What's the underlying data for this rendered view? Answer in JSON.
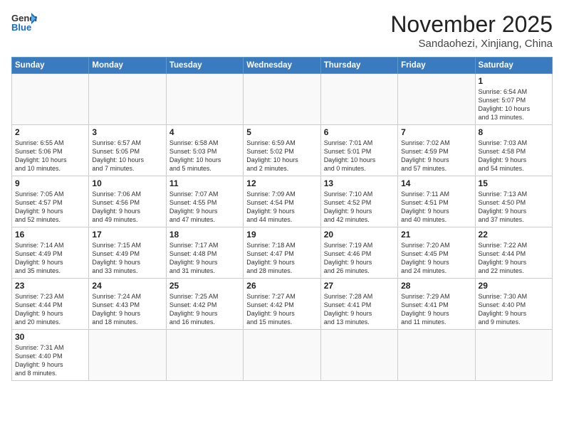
{
  "logo": {
    "text_general": "General",
    "text_blue": "Blue"
  },
  "header": {
    "month": "November 2025",
    "location": "Sandaohezi, Xinjiang, China"
  },
  "weekdays": [
    "Sunday",
    "Monday",
    "Tuesday",
    "Wednesday",
    "Thursday",
    "Friday",
    "Saturday"
  ],
  "weeks": [
    [
      null,
      null,
      null,
      null,
      null,
      null,
      {
        "day": "1",
        "info": "Sunrise: 6:54 AM\nSunset: 5:07 PM\nDaylight: 10 hours\nand 13 minutes."
      }
    ],
    [
      {
        "day": "2",
        "info": "Sunrise: 6:55 AM\nSunset: 5:06 PM\nDaylight: 10 hours\nand 10 minutes."
      },
      {
        "day": "3",
        "info": "Sunrise: 6:57 AM\nSunset: 5:05 PM\nDaylight: 10 hours\nand 7 minutes."
      },
      {
        "day": "4",
        "info": "Sunrise: 6:58 AM\nSunset: 5:03 PM\nDaylight: 10 hours\nand 5 minutes."
      },
      {
        "day": "5",
        "info": "Sunrise: 6:59 AM\nSunset: 5:02 PM\nDaylight: 10 hours\nand 2 minutes."
      },
      {
        "day": "6",
        "info": "Sunrise: 7:01 AM\nSunset: 5:01 PM\nDaylight: 10 hours\nand 0 minutes."
      },
      {
        "day": "7",
        "info": "Sunrise: 7:02 AM\nSunset: 4:59 PM\nDaylight: 9 hours\nand 57 minutes."
      },
      {
        "day": "8",
        "info": "Sunrise: 7:03 AM\nSunset: 4:58 PM\nDaylight: 9 hours\nand 54 minutes."
      }
    ],
    [
      {
        "day": "9",
        "info": "Sunrise: 7:05 AM\nSunset: 4:57 PM\nDaylight: 9 hours\nand 52 minutes."
      },
      {
        "day": "10",
        "info": "Sunrise: 7:06 AM\nSunset: 4:56 PM\nDaylight: 9 hours\nand 49 minutes."
      },
      {
        "day": "11",
        "info": "Sunrise: 7:07 AM\nSunset: 4:55 PM\nDaylight: 9 hours\nand 47 minutes."
      },
      {
        "day": "12",
        "info": "Sunrise: 7:09 AM\nSunset: 4:54 PM\nDaylight: 9 hours\nand 44 minutes."
      },
      {
        "day": "13",
        "info": "Sunrise: 7:10 AM\nSunset: 4:52 PM\nDaylight: 9 hours\nand 42 minutes."
      },
      {
        "day": "14",
        "info": "Sunrise: 7:11 AM\nSunset: 4:51 PM\nDaylight: 9 hours\nand 40 minutes."
      },
      {
        "day": "15",
        "info": "Sunrise: 7:13 AM\nSunset: 4:50 PM\nDaylight: 9 hours\nand 37 minutes."
      }
    ],
    [
      {
        "day": "16",
        "info": "Sunrise: 7:14 AM\nSunset: 4:49 PM\nDaylight: 9 hours\nand 35 minutes."
      },
      {
        "day": "17",
        "info": "Sunrise: 7:15 AM\nSunset: 4:49 PM\nDaylight: 9 hours\nand 33 minutes."
      },
      {
        "day": "18",
        "info": "Sunrise: 7:17 AM\nSunset: 4:48 PM\nDaylight: 9 hours\nand 31 minutes."
      },
      {
        "day": "19",
        "info": "Sunrise: 7:18 AM\nSunset: 4:47 PM\nDaylight: 9 hours\nand 28 minutes."
      },
      {
        "day": "20",
        "info": "Sunrise: 7:19 AM\nSunset: 4:46 PM\nDaylight: 9 hours\nand 26 minutes."
      },
      {
        "day": "21",
        "info": "Sunrise: 7:20 AM\nSunset: 4:45 PM\nDaylight: 9 hours\nand 24 minutes."
      },
      {
        "day": "22",
        "info": "Sunrise: 7:22 AM\nSunset: 4:44 PM\nDaylight: 9 hours\nand 22 minutes."
      }
    ],
    [
      {
        "day": "23",
        "info": "Sunrise: 7:23 AM\nSunset: 4:44 PM\nDaylight: 9 hours\nand 20 minutes."
      },
      {
        "day": "24",
        "info": "Sunrise: 7:24 AM\nSunset: 4:43 PM\nDaylight: 9 hours\nand 18 minutes."
      },
      {
        "day": "25",
        "info": "Sunrise: 7:25 AM\nSunset: 4:42 PM\nDaylight: 9 hours\nand 16 minutes."
      },
      {
        "day": "26",
        "info": "Sunrise: 7:27 AM\nSunset: 4:42 PM\nDaylight: 9 hours\nand 15 minutes."
      },
      {
        "day": "27",
        "info": "Sunrise: 7:28 AM\nSunset: 4:41 PM\nDaylight: 9 hours\nand 13 minutes."
      },
      {
        "day": "28",
        "info": "Sunrise: 7:29 AM\nSunset: 4:41 PM\nDaylight: 9 hours\nand 11 minutes."
      },
      {
        "day": "29",
        "info": "Sunrise: 7:30 AM\nSunset: 4:40 PM\nDaylight: 9 hours\nand 9 minutes."
      }
    ],
    [
      {
        "day": "30",
        "info": "Sunrise: 7:31 AM\nSunset: 4:40 PM\nDaylight: 9 hours\nand 8 minutes."
      },
      null,
      null,
      null,
      null,
      null,
      null
    ]
  ]
}
